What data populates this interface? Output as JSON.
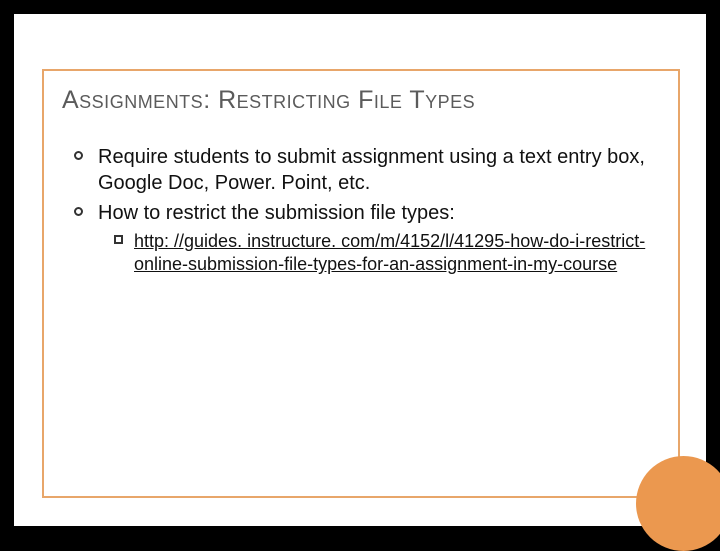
{
  "title": "Assignments: Restricting File Types",
  "bullets": [
    {
      "text": "Require students to submit assignment using a text entry box, Google Doc, Power. Point, etc."
    },
    {
      "text": "How to restrict the submission file types:"
    }
  ],
  "sub_link_text": "http: //guides. instructure. com/m/4152/l/41295-how-do-i-restrict-online-submission-file-types-for-an-assignment-in-my-course"
}
